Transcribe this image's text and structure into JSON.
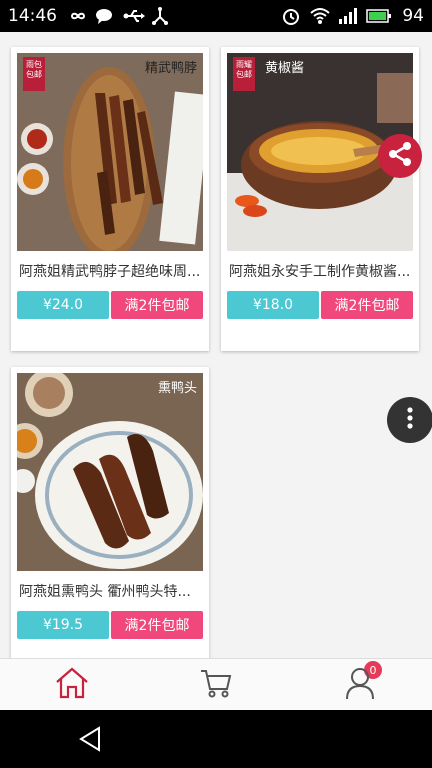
{
  "status_bar": {
    "time": "14:46",
    "icons_left": [
      "infinity-icon",
      "chat-bubble-icon",
      "usb-icon",
      "network-icon"
    ],
    "icons_right": [
      "alarm-icon",
      "wifi-icon",
      "signal-icon",
      "battery-icon"
    ],
    "battery": "94"
  },
  "products": [
    {
      "name": "阿燕姐精武鸭脖子超绝味周...",
      "price": "¥24.0",
      "shipping": "满2件包邮",
      "stamp": "雨包包邮",
      "watermark": "精武鸭脖"
    },
    {
      "name": "阿燕姐永安手工制作黄椒酱...",
      "price": "¥18.0",
      "shipping": "满2件包邮",
      "stamp": "雨耀包邮",
      "watermark": "黄椒酱"
    },
    {
      "name": "阿燕姐熏鸭头 衢州鸭头特...",
      "price": "¥19.5",
      "shipping": "满2件包邮",
      "watermark": "熏鸭头"
    }
  ],
  "tabbar": {
    "cart_badge": "0",
    "items": [
      "home-icon",
      "cart-icon",
      "profile-icon"
    ]
  },
  "colors": {
    "accent": "#c8223e",
    "price_button": "#4cc8d2",
    "shipping_button": "#f0487c"
  }
}
